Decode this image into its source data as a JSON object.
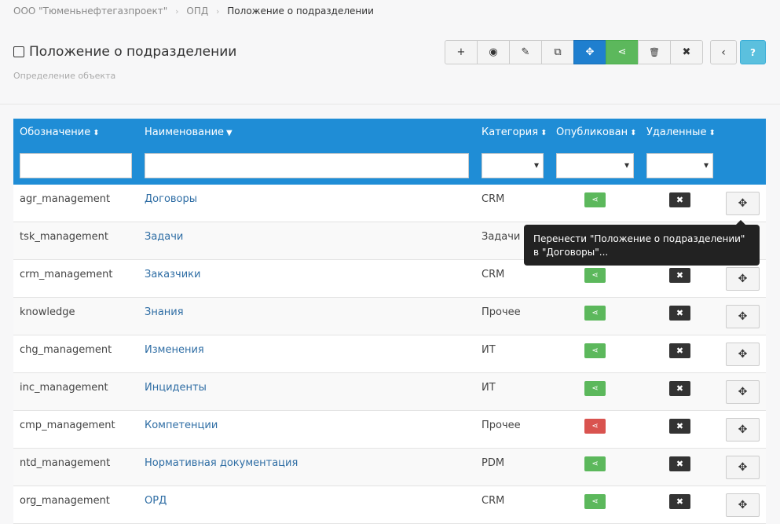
{
  "breadcrumb": {
    "items": [
      "ООО \"Тюменьнефтегазпроект\"",
      "ОПД"
    ],
    "current": "Положение о подразделении"
  },
  "page": {
    "title": "Положение о подразделении",
    "subtitle": "Определение объекта"
  },
  "toolbar": {
    "buttons": [
      {
        "icon": "plus-icon",
        "glyph": "+"
      },
      {
        "icon": "eye-icon",
        "glyph": "◉"
      },
      {
        "icon": "edit-icon",
        "glyph": "✎"
      },
      {
        "icon": "copy-icon",
        "glyph": "⧉"
      },
      {
        "icon": "move-icon",
        "glyph": "✥"
      },
      {
        "icon": "share-icon",
        "glyph": "⋖"
      },
      {
        "icon": "trash-icon",
        "glyph": "🗑"
      },
      {
        "icon": "close-icon",
        "glyph": "✖"
      }
    ],
    "back_glyph": "‹",
    "help_glyph": "?",
    "accent_blue": "#1f7fcf",
    "accent_green": "#5cb85c"
  },
  "table": {
    "headers": {
      "code": "Обозначение",
      "name": "Наименование",
      "category": "Категория",
      "published": "Опубликован",
      "deleted": "Удаленные"
    },
    "rows": [
      {
        "code": "agr_management",
        "name": "Договоры",
        "category": "CRM",
        "published": true
      },
      {
        "code": "tsk_management",
        "name": "Задачи",
        "category": "Задачи",
        "published": true
      },
      {
        "code": "crm_management",
        "name": "Заказчики",
        "category": "CRM",
        "published": true
      },
      {
        "code": "knowledge",
        "name": "Знания",
        "category": "Прочее",
        "published": true
      },
      {
        "code": "chg_management",
        "name": "Изменения",
        "category": "ИТ",
        "published": true
      },
      {
        "code": "inc_management",
        "name": "Инциденты",
        "category": "ИТ",
        "published": true
      },
      {
        "code": "cmp_management",
        "name": "Компетенции",
        "category": "Прочее",
        "published": false
      },
      {
        "code": "ntd_management",
        "name": "Нормативная документация",
        "category": "PDM",
        "published": true
      },
      {
        "code": "org_management",
        "name": "ОРД",
        "category": "CRM",
        "published": true
      }
    ]
  },
  "tooltip": {
    "text": "Перенести \"Положение о подразделении\" в \"Договоры\"..."
  }
}
